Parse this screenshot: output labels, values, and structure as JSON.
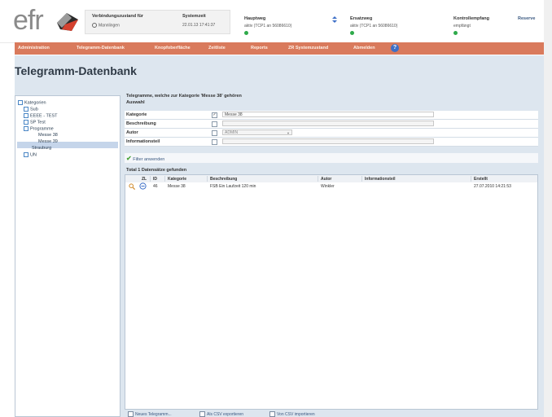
{
  "header": {
    "logo": "efr",
    "connection": {
      "title": "Verbindungszustand für",
      "value": "Mannlingen"
    },
    "system_time": {
      "title": "Systemzeit",
      "value": "22.01.13 17:41:37"
    },
    "main_route": {
      "title": "Hauptweg",
      "value": "aktiv (TCP1 an 56086610)"
    },
    "alt_route": {
      "title": "Ersatzweg",
      "value": "aktiv (TCP1 an 56086610)"
    },
    "control_reception": {
      "title": "Kontrollempfang",
      "value": "empfängt"
    },
    "reserve": {
      "title": "Reserve"
    },
    "status_color": "#2eaa4a"
  },
  "menu": {
    "items": [
      "Administration",
      "Telegramm-Datenbank",
      "Knopfoberfläche",
      "Zeitliste",
      "Reports",
      "ZR Systemzustand",
      "Abmelden"
    ],
    "help_glyph": "?"
  },
  "page": {
    "title": "Telegramm-Datenbank"
  },
  "tree": {
    "items": [
      "Kategorien",
      "Sub",
      "EEEE - TEST",
      "SP Test",
      "Programme",
      "Messe 38",
      "Messe 39",
      "Strauburg",
      "UN"
    ]
  },
  "panel": {
    "heading": "Telegramme, welche zur Kategorie 'Messe 38' gehören",
    "section": "Auswahl",
    "fields": [
      {
        "label": "Kategorie",
        "checked": "✓",
        "value": "Messe 38"
      },
      {
        "label": "Beschreibung",
        "checked": "",
        "value": ""
      },
      {
        "label": "Autor",
        "checked": "",
        "value": "ADMIN"
      },
      {
        "label": "Informationsteil",
        "checked": "",
        "value": ""
      }
    ],
    "filter_button": "Filter anwenden",
    "result_count": "Total 1 Datensätze gefunden"
  },
  "grid": {
    "columns": [
      "ZL",
      "ID",
      "Kategorie",
      "Beschreibung",
      "Autor",
      "Informationsteil",
      "Erstellt"
    ],
    "rows": [
      {
        "id": "46",
        "category": "Messe 38",
        "description": "FSB Ein Laufzeit 120 min",
        "author": "Winkler",
        "info": "",
        "created": "27.07.2010 14:21:53"
      }
    ]
  },
  "toolbar": {
    "new_label": "Neues Telegramm...",
    "export_label": "Als CSV exportieren",
    "import_label": "Von CSV importieren"
  }
}
